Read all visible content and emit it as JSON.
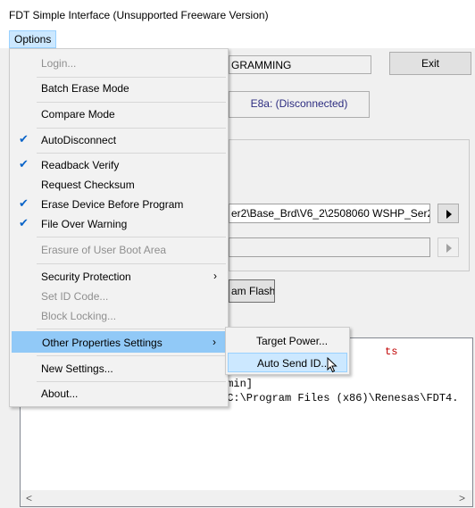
{
  "window": {
    "title": "FDT Simple Interface   (Unsupported Freeware Version)"
  },
  "menubar": {
    "options_label": "Options"
  },
  "main": {
    "status_text": "GRAMMING",
    "exit_label": "Exit",
    "connection_text": "E8a: (Disconnected)",
    "file_path": "er2\\Base_Brd\\V6_2\\2508060 WSHP_Ser2_",
    "flash_button_label": "am Flash",
    "log_line_1": "ts",
    "log_line_2": "dmin]",
    "log_line_3": "(C:\\Program Files (x86)\\Renesas\\FDT4.",
    "scroll_left": "<",
    "scroll_right": ">"
  },
  "options_menu": {
    "items": [
      {
        "label": "Login...",
        "checked": false,
        "disabled": true
      },
      {
        "label": "Batch Erase Mode",
        "checked": false,
        "disabled": false
      },
      {
        "label": "Compare Mode",
        "checked": false,
        "disabled": false
      },
      {
        "label": "AutoDisconnect",
        "checked": true,
        "disabled": false
      },
      {
        "label": "Readback Verify",
        "checked": true,
        "disabled": false
      },
      {
        "label": "Request Checksum",
        "checked": false,
        "disabled": false
      },
      {
        "label": "Erase Device Before Program",
        "checked": true,
        "disabled": false
      },
      {
        "label": "File Over Warning",
        "checked": true,
        "disabled": false
      },
      {
        "label": "Erasure of User Boot Area",
        "checked": false,
        "disabled": true
      },
      {
        "label": "Security Protection",
        "checked": false,
        "disabled": false,
        "submenu": true
      },
      {
        "label": "Set ID Code...",
        "checked": false,
        "disabled": true
      },
      {
        "label": "Block Locking...",
        "checked": false,
        "disabled": true
      },
      {
        "label": "Other Properties Settings",
        "checked": false,
        "disabled": false,
        "submenu": true,
        "highlighted": true
      },
      {
        "label": "New Settings...",
        "checked": false,
        "disabled": false
      },
      {
        "label": "About...",
        "checked": false,
        "disabled": false
      }
    ]
  },
  "other_properties_submenu": {
    "items": [
      {
        "label": "Target Power..."
      },
      {
        "label": "Auto Send ID...",
        "highlighted": true
      }
    ]
  },
  "icons": {
    "check": "check-icon",
    "submenu_arrow": "chevron-right-icon",
    "cursor": "mouse-pointer-icon",
    "run": "play-arrow-icon"
  },
  "colors": {
    "menu_highlight": "#91c9f7",
    "submenu_highlight": "#cce8ff",
    "check": "#0a64c8"
  }
}
